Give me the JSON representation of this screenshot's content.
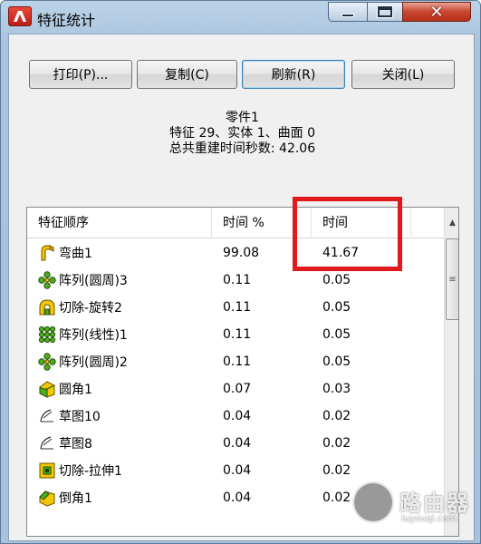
{
  "window": {
    "title": "特征统计"
  },
  "buttons": {
    "print": "打印(P)...",
    "copy": "复制(C)",
    "refresh": "刷新(R)",
    "close": "关闭(L)"
  },
  "summary": {
    "line1": "零件1",
    "line2": "特征 29、实体 1、曲面 0",
    "line3": "总共重建时间秒数: 42.06"
  },
  "table": {
    "columns": [
      "特征顺序",
      "时间 %",
      "时间"
    ],
    "rows": [
      {
        "icon": "flex-feature-icon",
        "name": "弯曲1",
        "pct": "99.08",
        "time": "41.67"
      },
      {
        "icon": "circular-pattern-icon",
        "name": "阵列(圆周)3",
        "pct": "0.11",
        "time": "0.05"
      },
      {
        "icon": "revolve-cut-icon",
        "name": "切除-旋转2",
        "pct": "0.11",
        "time": "0.05"
      },
      {
        "icon": "linear-pattern-icon",
        "name": "阵列(线性)1",
        "pct": "0.11",
        "time": "0.05"
      },
      {
        "icon": "circular-pattern-icon",
        "name": "阵列(圆周)2",
        "pct": "0.11",
        "time": "0.05"
      },
      {
        "icon": "fillet-icon",
        "name": "圆角1",
        "pct": "0.07",
        "time": "0.03"
      },
      {
        "icon": "sketch-icon",
        "name": "草图10",
        "pct": "0.04",
        "time": "0.02"
      },
      {
        "icon": "sketch-icon",
        "name": "草图8",
        "pct": "0.04",
        "time": "0.02"
      },
      {
        "icon": "extrude-cut-icon",
        "name": "切除-拉伸1",
        "pct": "0.04",
        "time": "0.02"
      },
      {
        "icon": "chamfer-icon",
        "name": "倒角1",
        "pct": "0.04",
        "time": "0.02"
      }
    ]
  },
  "watermark": {
    "name": "路由器",
    "url": "luyouqi.com"
  },
  "colors": {
    "highlight": "#e1191c",
    "feature_yellow": "#f2c600",
    "feature_green": "#4caf1a"
  }
}
